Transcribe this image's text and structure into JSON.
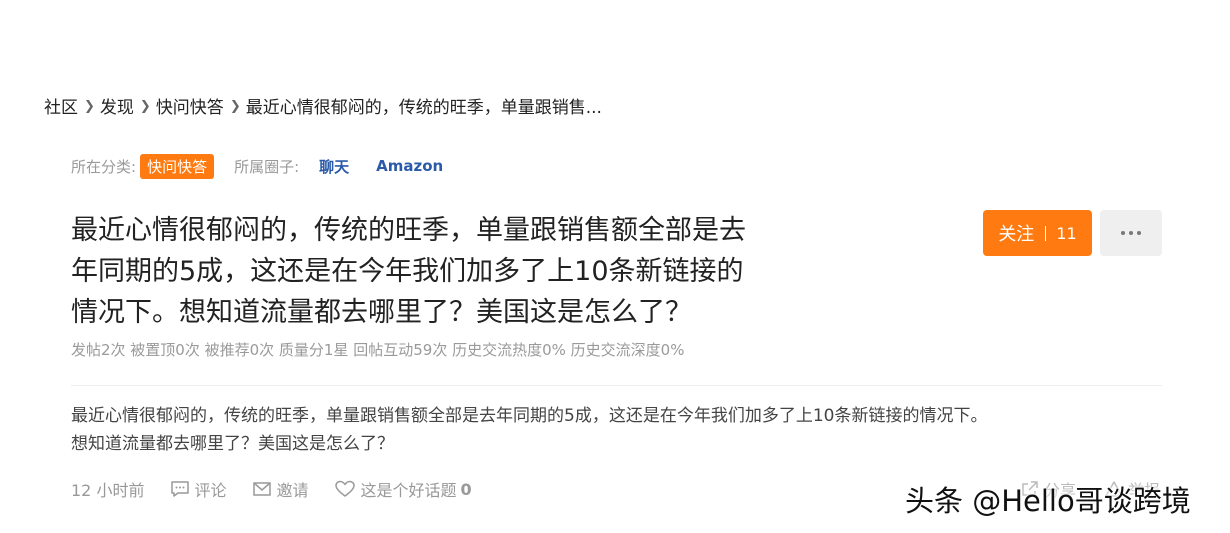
{
  "breadcrumb": {
    "items": [
      "社区",
      "发现",
      "快问快答"
    ],
    "current": "最近心情很郁闷的，传统的旺季，单量跟销售..."
  },
  "meta": {
    "category_label": "所在分类:",
    "category_value": "快问快答",
    "circle_label": "所属圈子:",
    "circles": [
      "聊天",
      "Amazon"
    ]
  },
  "post": {
    "title_lines": [
      "最近心情很郁闷的，传统的旺季，单量跟销售额全部是去",
      "年同期的5成，这还是在今年我们加多了上10条新链接的",
      "情况下。想知道流量都去哪里了？美国这是怎么了？"
    ],
    "stats": "发帖2次 被置顶0次 被推荐0次 质量分1星 回帖互动59次 历史交流热度0% 历史交流深度0%",
    "body_lines": [
      "最近心情很郁闷的，传统的旺季，单量跟销售额全部是去年同期的5成，这还是在今年我们加多了上10条新链接的情况下。",
      "想知道流量都去哪里了？美国这是怎么了？"
    ]
  },
  "follow": {
    "label": "关注",
    "count": "11"
  },
  "actions": {
    "time": "12 小时前",
    "comment": "评论",
    "invite": "邀请",
    "good_topic": "这是个好话题",
    "good_count": "0",
    "share": "分享",
    "report": "举报"
  },
  "watermark": "头条 @Hello哥谈跨境",
  "colors": {
    "accent": "#ff7a10",
    "link": "#2a5aa8",
    "muted": "#9a9a9a"
  },
  "icons": {
    "breadcrumb_separator": "chevron-right-icon",
    "more": "more-dots-icon",
    "comment": "comment-icon",
    "invite": "mail-icon",
    "good_topic": "heart-icon",
    "share": "share-icon",
    "report": "report-icon"
  }
}
